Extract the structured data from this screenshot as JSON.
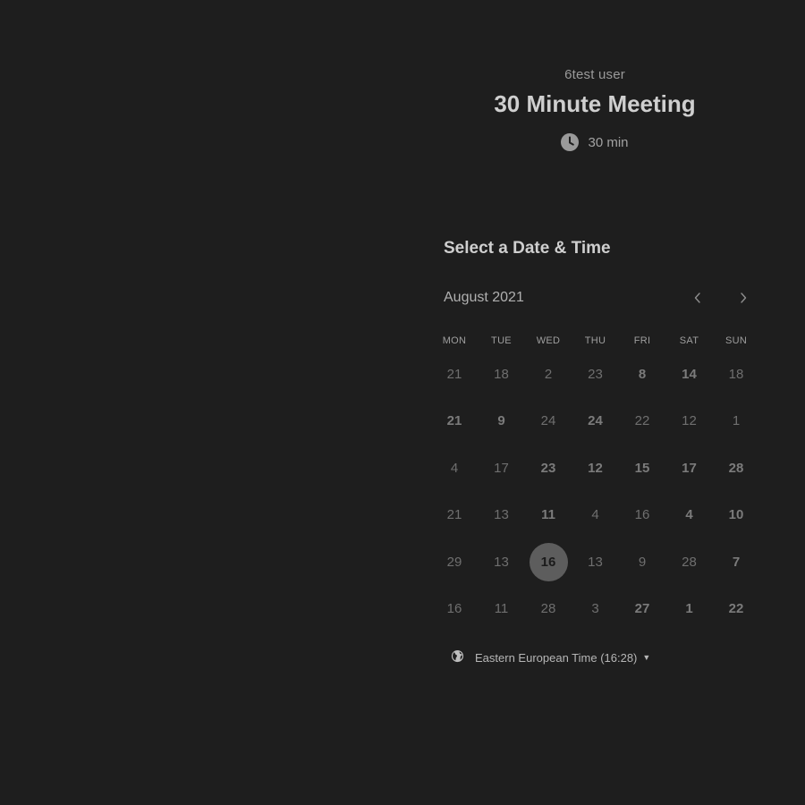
{
  "header": {
    "user_name": "6test user",
    "event_title": "30 Minute Meeting",
    "duration": "30 min"
  },
  "calendar": {
    "section_title": "Select a Date & Time",
    "month_label": "August 2021",
    "weekdays": [
      "MON",
      "TUE",
      "WED",
      "THU",
      "FRI",
      "SAT",
      "SUN"
    ],
    "selected_day": "16",
    "rows": [
      [
        {
          "d": "21",
          "a": false
        },
        {
          "d": "18",
          "a": false
        },
        {
          "d": "2",
          "a": false
        },
        {
          "d": "23",
          "a": false
        },
        {
          "d": "8",
          "a": true
        },
        {
          "d": "14",
          "a": true
        },
        {
          "d": "18",
          "a": false
        }
      ],
      [
        {
          "d": "21",
          "a": true
        },
        {
          "d": "9",
          "a": true
        },
        {
          "d": "24",
          "a": false
        },
        {
          "d": "24",
          "a": true
        },
        {
          "d": "22",
          "a": false
        },
        {
          "d": "12",
          "a": false
        },
        {
          "d": "1",
          "a": false
        }
      ],
      [
        {
          "d": "4",
          "a": false
        },
        {
          "d": "17",
          "a": false
        },
        {
          "d": "23",
          "a": true
        },
        {
          "d": "12",
          "a": true
        },
        {
          "d": "15",
          "a": true
        },
        {
          "d": "17",
          "a": true
        },
        {
          "d": "28",
          "a": true
        }
      ],
      [
        {
          "d": "21",
          "a": false
        },
        {
          "d": "13",
          "a": false
        },
        {
          "d": "11",
          "a": true
        },
        {
          "d": "4",
          "a": false
        },
        {
          "d": "16",
          "a": false
        },
        {
          "d": "4",
          "a": true
        },
        {
          "d": "10",
          "a": true
        }
      ],
      [
        {
          "d": "29",
          "a": false
        },
        {
          "d": "13",
          "a": false
        },
        {
          "d": "16",
          "a": true,
          "selected": true
        },
        {
          "d": "13",
          "a": false
        },
        {
          "d": "9",
          "a": false
        },
        {
          "d": "28",
          "a": false
        },
        {
          "d": "7",
          "a": true
        }
      ],
      [
        {
          "d": "16",
          "a": false
        },
        {
          "d": "11",
          "a": false
        },
        {
          "d": "28",
          "a": false
        },
        {
          "d": "3",
          "a": false
        },
        {
          "d": "27",
          "a": true
        },
        {
          "d": "1",
          "a": true
        },
        {
          "d": "22",
          "a": true
        }
      ]
    ]
  },
  "timezone": {
    "label": "Eastern European Time (16:28)"
  },
  "icons": {
    "duration": "clock-icon",
    "prev": "chevron-left-icon",
    "next": "chevron-right-icon",
    "timezone": "globe-icon",
    "dropdown": "caret-down-icon"
  },
  "colors": {
    "background": "#1e1e1e",
    "selected_circle": "#5d5d5d"
  }
}
